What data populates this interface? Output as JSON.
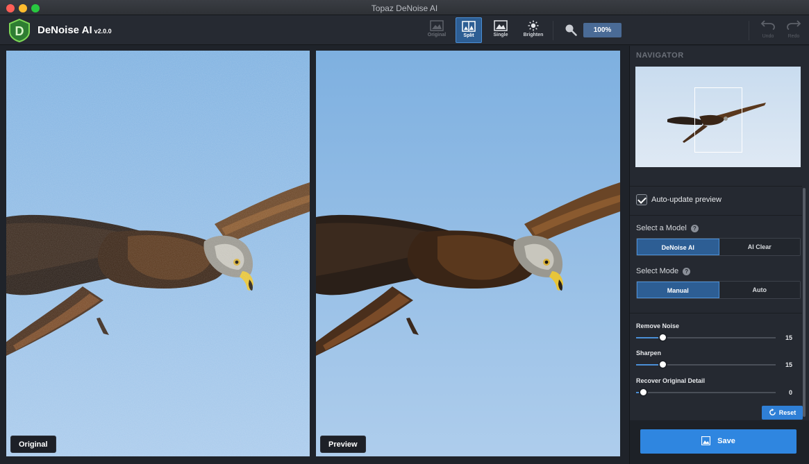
{
  "window": {
    "title": "Topaz DeNoise AI"
  },
  "app": {
    "name": "DeNoise AI",
    "version": "v2.0.0"
  },
  "toolbar": {
    "views": [
      {
        "label": "Original",
        "state": "disabled"
      },
      {
        "label": "Split",
        "state": "active"
      },
      {
        "label": "Single",
        "state": "normal"
      },
      {
        "label": "Brighten",
        "state": "normal"
      }
    ],
    "zoom": "100%",
    "undo_label": "Undo",
    "redo_label": "Redo"
  },
  "panes": {
    "left_label": "Original",
    "right_label": "Preview"
  },
  "sidebar": {
    "navigator_title": "NAVIGATOR",
    "auto_update_label": "Auto-update preview",
    "auto_update_checked": true,
    "model_label": "Select a Model",
    "models": [
      "DeNoise AI",
      "AI Clear"
    ],
    "selected_model": "DeNoise AI",
    "mode_label": "Select Mode",
    "modes": [
      "Manual",
      "Auto"
    ],
    "selected_mode": "Manual",
    "help_glyph": "?",
    "sliders": [
      {
        "label": "Remove Noise",
        "value": "15",
        "fraction": 0.19
      },
      {
        "label": "Sharpen",
        "value": "15",
        "fraction": 0.19
      },
      {
        "label": "Recover Original Detail",
        "value": "0",
        "fraction": 0.05
      }
    ],
    "reset_label": "Reset",
    "save_label": "Save"
  },
  "colors": {
    "accent": "#2f86e0",
    "active_button": "#2d5e94",
    "sky_top": "#7eb0e0",
    "sky_bottom": "#aecdec"
  }
}
